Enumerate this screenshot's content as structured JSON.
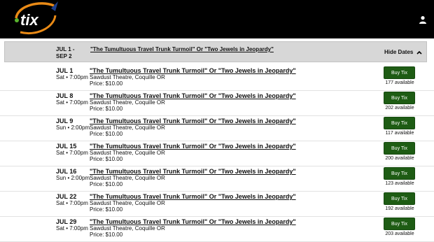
{
  "header": {
    "logo_text": "tix",
    "colors": {
      "logo_orange": "#e98a16",
      "logo_green": "#59b52e",
      "logo_blue": "#1c3e8c"
    },
    "user_icon": "user-icon"
  },
  "summary": {
    "date_range": [
      "JUL 1 -",
      "SEP 2"
    ],
    "title": "\"The Tumultuous Travel Trunk Turmoil\" Or \"Two Jewels in Jeopardy\"",
    "hide_dates_label": "Hide Dates"
  },
  "performances": [
    {
      "date": "JUL 1",
      "time": "Sat • 7:00pm",
      "title": "\"The Tumultuous Travel Trunk Turmoil\" Or \"Two Jewels in Jeopardy\"",
      "venue": "Sawdust Theatre, Coquille OR",
      "price": "Price: $10.00",
      "buy_label": "Buy Tix",
      "available": "177 available"
    },
    {
      "date": "JUL 8",
      "time": "Sat • 7:00pm",
      "title": "\"The Tumultuous Travel Trunk Turmoil\" Or \"Two Jewels in Jeopardy\"",
      "venue": "Sawdust Theatre, Coquille OR",
      "price": "Price: $10.00",
      "buy_label": "Buy Tix",
      "available": "202 available"
    },
    {
      "date": "JUL 9",
      "time": "Sun • 2:00pm",
      "title": "\"The Tumultuous Travel Trunk Turmoil\" Or \"Two Jewels in Jeopardy\"",
      "venue": "Sawdust Theatre, Coquille OR",
      "price": "Price: $10.00",
      "buy_label": "Buy Tix",
      "available": "117 available"
    },
    {
      "date": "JUL 15",
      "time": "Sat • 7:00pm",
      "title": "\"The Tumultuous Travel Trunk Turmoil\" Or \"Two Jewels in Jeopardy\"",
      "venue": "Sawdust Theatre, Coquille OR",
      "price": "Price: $10.00",
      "buy_label": "Buy Tix",
      "available": "200 available"
    },
    {
      "date": "JUL 16",
      "time": "Sun • 2:00pm",
      "title": "\"The Tumultuous Travel Trunk Turmoil\" Or \"Two Jewels in Jeopardy\"",
      "venue": "Sawdust Theatre, Coquille OR",
      "price": "Price: $10.00",
      "buy_label": "Buy Tix",
      "available": "123 available"
    },
    {
      "date": "JUL 22",
      "time": "Sat • 7:00pm",
      "title": "\"The Tumultuous Travel Trunk Turmoil\" Or \"Two Jewels in Jeopardy\"",
      "venue": "Sawdust Theatre, Coquille OR",
      "price": "Price: $10.00",
      "buy_label": "Buy Tix",
      "available": "192 available"
    },
    {
      "date": "JUL 29",
      "time": "Sat • 7:00pm",
      "title": "\"The Tumultuous Travel Trunk Turmoil\" Or \"Two Jewels in Jeopardy\"",
      "venue": "Sawdust Theatre, Coquille OR",
      "price": "Price: $10.00",
      "buy_label": "Buy Tix",
      "available": "203 available"
    }
  ],
  "colors": {
    "buy_button": "#1e5c14",
    "header_bg": "#000000",
    "summary_bg": "#d7d7d7"
  }
}
